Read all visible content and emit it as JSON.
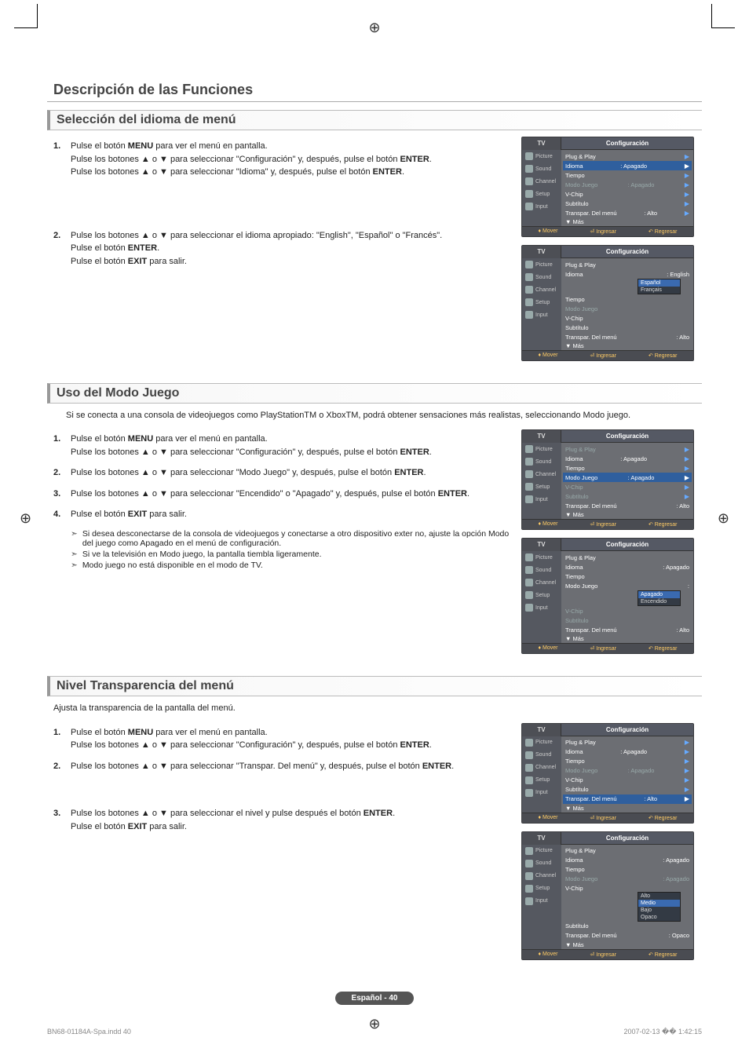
{
  "main_heading": "Descripción de las Funciones",
  "sections": {
    "seleccion": {
      "heading": "Selección del idioma de menú",
      "step1": "Pulse el botón MENU para ver el menú en pantalla.\nPulse los botones ▲ o ▼ para seleccionar \"Configuración\" y, después, pulse el botón ENTER.\nPulse los botones ▲ o ▼ para seleccionar \"Idioma\" y, después, pulse el botón ENTER.",
      "step2": "Pulse los botones ▲ o ▼ para seleccionar el idioma apropiado: \"English\", \"Español\" o \"Francés\".\nPulse el botón ENTER.\nPulse el botón EXIT para salir."
    },
    "juego": {
      "heading": "Uso del Modo Juego",
      "intro": "Si se conecta a una consola de videojuegos como PlayStationTM o XboxTM, podrá obtener sensaciones más realistas, seleccionando Modo juego.",
      "step1": "Pulse el botón MENU para ver el menú en pantalla.\nPulse los botones ▲ o ▼ para seleccionar \"Configuración\" y, después, pulse el botón ENTER.",
      "step2": "Pulse los botones ▲ o ▼ para seleccionar \"Modo Juego\" y, después, pulse el botón ENTER.",
      "step3": "Pulse los botones ▲ o ▼ para seleccionar \"Encendido\" o \"Apagado\" y, después, pulse el botón ENTER.",
      "step4": "Pulse el botón EXIT para salir.",
      "note1": "Si desea desconectarse de la consola de videojuegos y conectarse a otro dispositivo exter no, ajuste la opción Modo del juego como Apagado en el menú de configuración.",
      "note2": "Si ve la televisión en Modo juego, la pantalla tiembla ligeramente.",
      "note3": "Modo juego no está disponible en el modo de TV."
    },
    "transp": {
      "heading": "Nivel Transparencia del menú",
      "intro": "Ajusta la transparencia de la pantalla del menú.",
      "step1": "Pulse el botón MENU para ver el menú en pantalla.\nPulse los botones ▲ o ▼ para seleccionar \"Configuración\" y, después, pulse el botón ENTER.",
      "step2": "Pulse los botones ▲ o ▼ para seleccionar \"Transpar. Del menú\" y, después, pulse el botón ENTER.",
      "step3": "Pulse los botones ▲ o ▼ para seleccionar el nivel y pulse después el botón ENTER.\nPulse el botón EXIT para salir."
    }
  },
  "osd_common": {
    "tv": "TV",
    "title": "Configuración",
    "sidebar": [
      "Picture",
      "Sound",
      "Channel",
      "Setup",
      "Input"
    ],
    "rows": {
      "plug": "Plug & Play",
      "idioma": "Idioma",
      "tiempo": "Tiempo",
      "modojuego": "Modo Juego",
      "vchip": "V-Chip",
      "subtitulo": "Subtítulo",
      "transpar": "Transpar. Del menú",
      "mas": "▼ Más"
    },
    "vals": {
      "apagado": ": Apagado",
      "alto": ": Alto",
      "english": ": English",
      "opaco": ": Opaco"
    },
    "langs": [
      "English",
      "Español",
      "Français"
    ],
    "juego_opts": [
      "Apagado",
      "Encendido"
    ],
    "transp_opts": [
      "Alto",
      "Medio",
      "Bajo",
      "Opaco"
    ],
    "footer": {
      "mover": "Mover",
      "ingresar": "Ingresar",
      "regresar": "Regresar"
    }
  },
  "page_badge": "Español - 40",
  "footer_left": "BN68-01184A-Spa.indd   40",
  "footer_right": "2007-02-13   �� 1:42:15"
}
